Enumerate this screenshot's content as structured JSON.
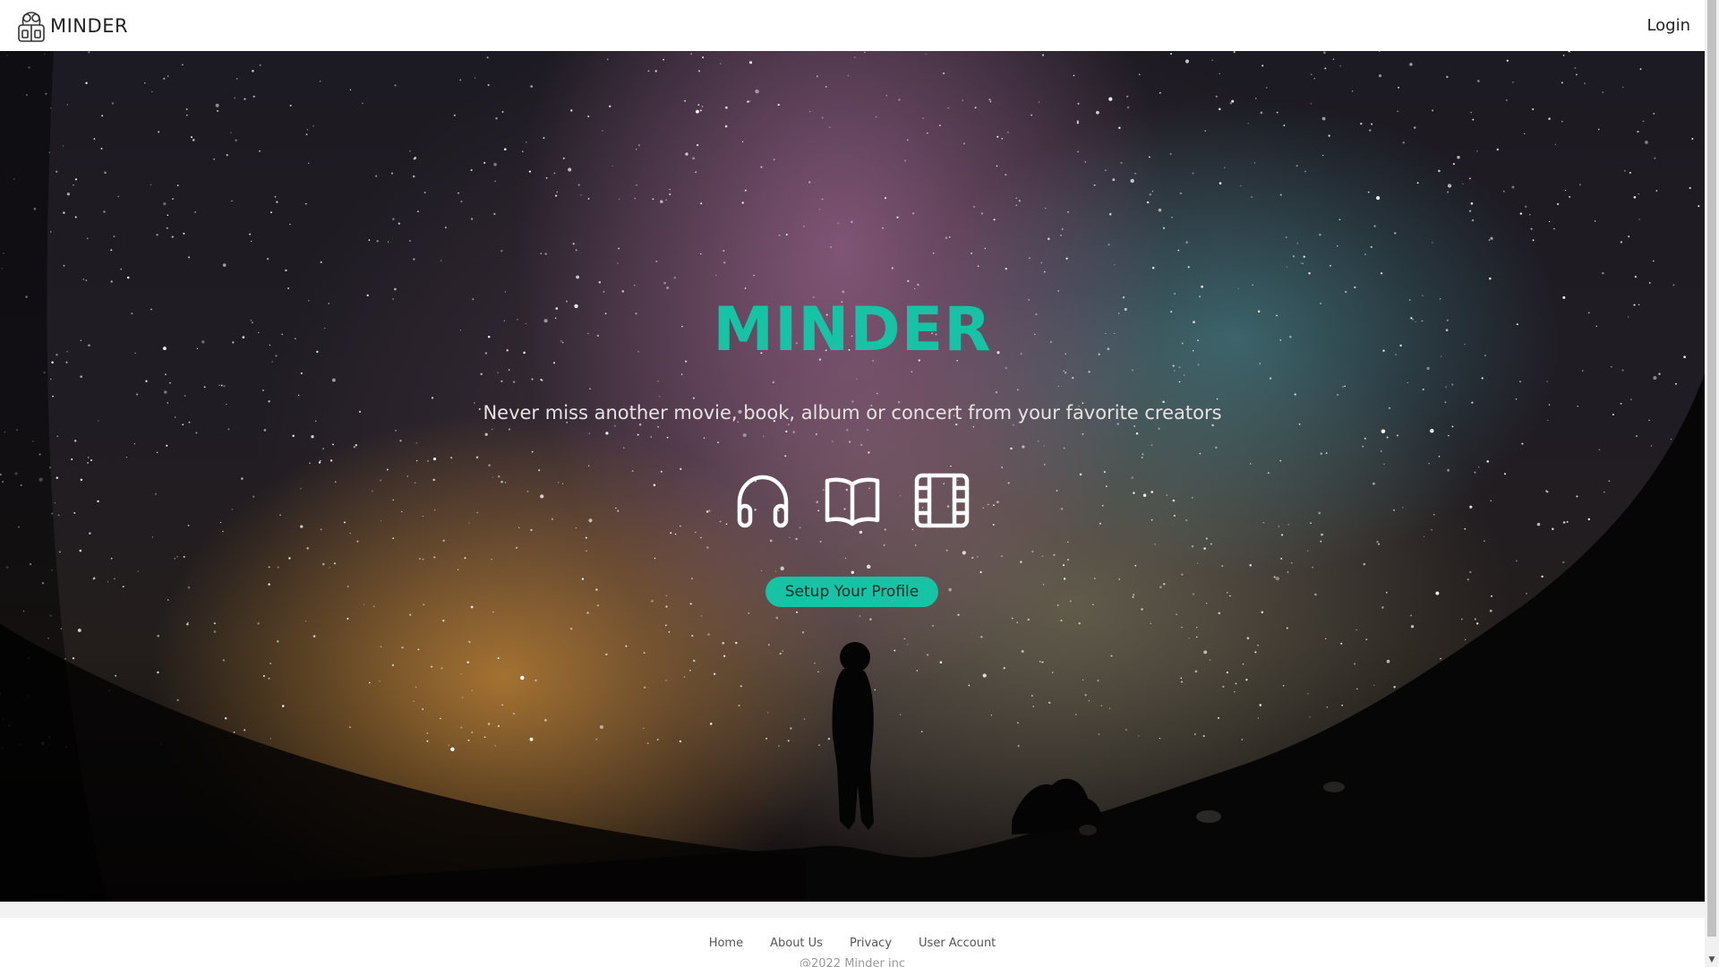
{
  "navbar": {
    "brand_name": "MINDER",
    "brand_icon": "minder-logo-icon",
    "login_label": "Login"
  },
  "hero": {
    "title": "MINDER",
    "tagline": "Never miss another movie, book, album or concert from your favorite creators",
    "icons": [
      "headphones-icon",
      "open-book-icon",
      "film-strip-icon"
    ],
    "cta_label": "Setup Your Profile",
    "background": "starry-night-sky-with-silhouette"
  },
  "footer": {
    "links": [
      {
        "label": "Home"
      },
      {
        "label": "About Us"
      },
      {
        "label": "Privacy"
      },
      {
        "label": "User Account"
      }
    ],
    "copyright": "@2022 Minder inc"
  },
  "colors": {
    "accent": "#16c3a4",
    "tagline": "#e6e2e2",
    "footer_band": "#f2f2f2"
  }
}
